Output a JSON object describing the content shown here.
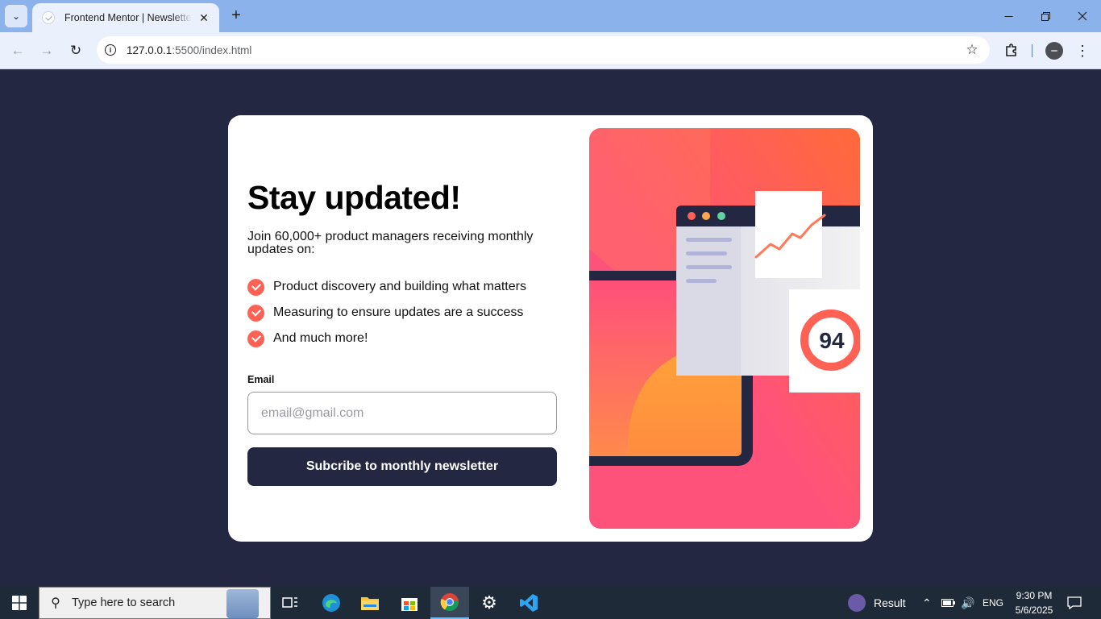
{
  "browser": {
    "tab_title": "Frontend Mentor | Newsletter sign-up form with success message",
    "url_host": "127.0.0.1",
    "url_path": ":5500/index.html"
  },
  "page": {
    "headline": "Stay updated!",
    "intro": "Join 60,000+ product managers receiving monthly updates on:",
    "features": [
      "Product discovery and building what matters",
      "Measuring to ensure updates are a success",
      "And much more!"
    ],
    "email_label": "Email",
    "email_placeholder": "email@gmail.com",
    "email_value": "",
    "submit_label": "Subcribe to monthly newsletter",
    "illustration": {
      "score": "94"
    },
    "colors": {
      "background": "#242742",
      "accent": "#ff6155",
      "card": "#ffffff",
      "button": "#242742"
    }
  },
  "taskbar": {
    "search_placeholder": "Type here to search",
    "weather_label": "Result",
    "language": "ENG",
    "time": "9:30 PM",
    "date": "5/6/2025"
  }
}
